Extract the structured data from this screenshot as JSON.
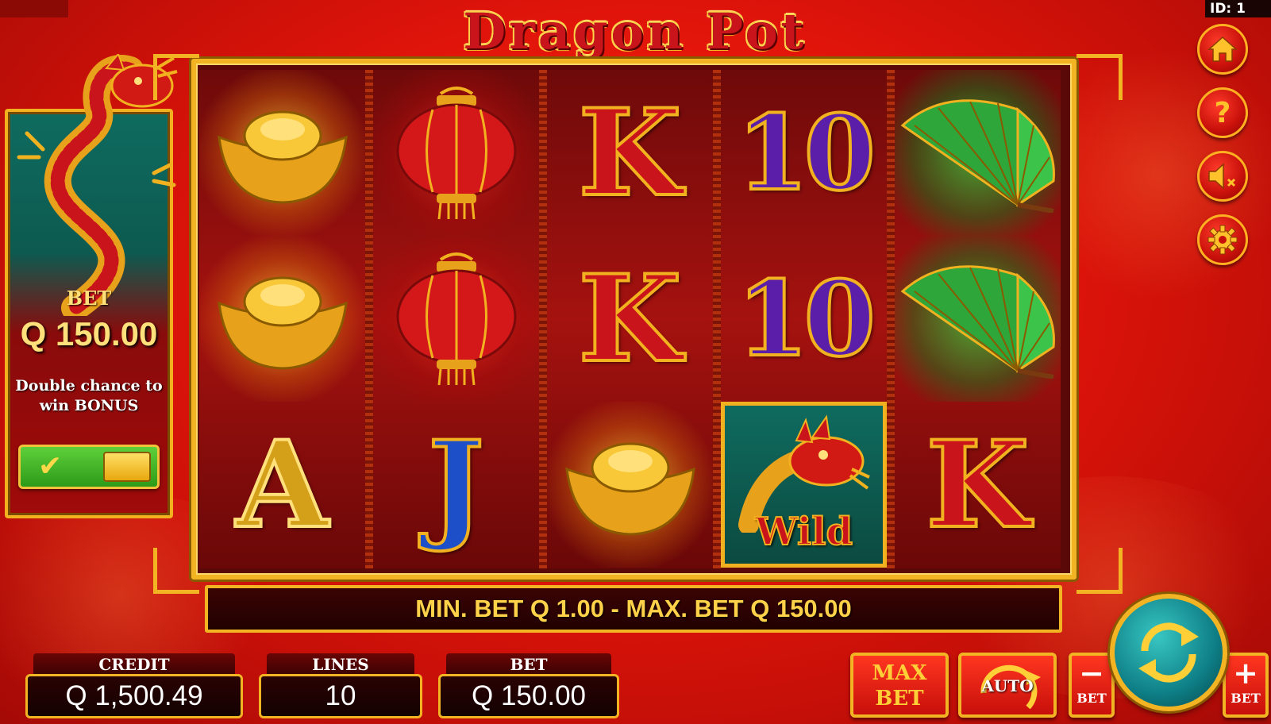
{
  "header": {
    "logo": "Dragon Pot",
    "id_label": "ID: 1"
  },
  "side_menu": {
    "home_icon": "home-icon",
    "help_label": "?",
    "sound_icon": "sound-muted-icon",
    "settings_icon": "gear-icon"
  },
  "bonus_panel": {
    "bet_label": "BET",
    "bet_value": "Q 150.00",
    "text": "Double chance to win BONUS",
    "toggle_on": true
  },
  "reels": [
    [
      "gold-ingot",
      "gold-ingot",
      "A"
    ],
    [
      "lantern",
      "lantern",
      "J"
    ],
    [
      "K",
      "K",
      "gold-ingot"
    ],
    [
      "10",
      "10",
      "wild"
    ],
    [
      "fan",
      "fan",
      "K"
    ]
  ],
  "wild_label": "Wild",
  "message": "MIN. BET Q 1.00 - MAX. BET Q 150.00",
  "meters": {
    "credit": {
      "label": "CREDIT",
      "value": "Q 1,500.49"
    },
    "lines": {
      "label": "LINES",
      "value": "10"
    },
    "bet": {
      "label": "BET",
      "value": "Q 150.00"
    }
  },
  "buttons": {
    "max_bet": "MAX BET",
    "auto": "AUTO",
    "minus_bet_sign": "−",
    "minus_bet_label": "BET",
    "plus_bet_sign": "+",
    "plus_bet_label": "BET"
  },
  "colors": {
    "frame_gold": "#f3b424",
    "background_red": "#e0140a",
    "spin_teal": "#0e7f86"
  }
}
